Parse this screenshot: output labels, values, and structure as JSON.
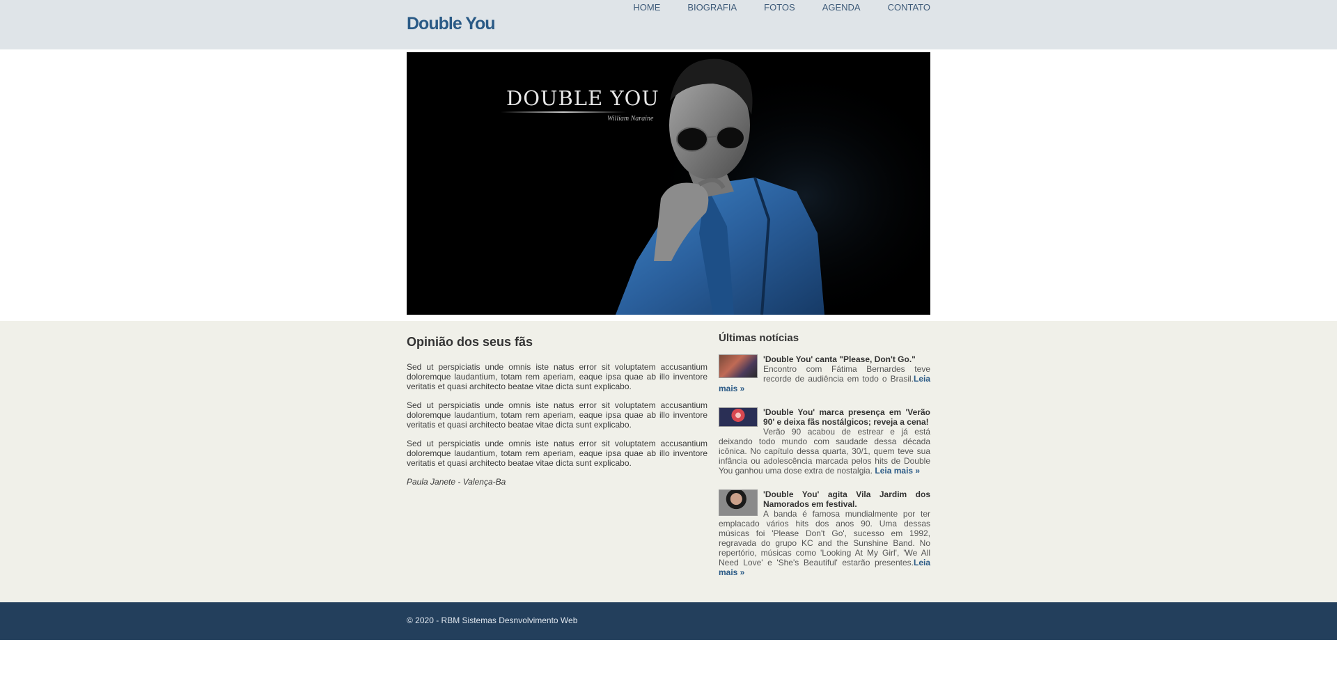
{
  "site": {
    "logo": "Double You"
  },
  "nav": {
    "items": [
      "HOME",
      "BIOGRAFIA",
      "FOTOS",
      "AGENDA",
      "CONTATO"
    ]
  },
  "hero": {
    "title": "DOUBLE YOU",
    "subtitle": "William Naraine"
  },
  "fans": {
    "heading": "Opinião dos seus fãs",
    "paragraphs": [
      "Sed ut perspiciatis unde omnis iste natus error sit voluptatem accusantium doloremque laudantium, totam rem aperiam, eaque ipsa quae ab illo inventore veritatis et quasi architecto beatae vitae dicta sunt explicabo.",
      "Sed ut perspiciatis unde omnis iste natus error sit voluptatem accusantium doloremque laudantium, totam rem aperiam, eaque ipsa quae ab illo inventore veritatis et quasi architecto beatae vitae dicta sunt explicabo.",
      "Sed ut perspiciatis unde omnis iste natus error sit voluptatem accusantium doloremque laudantium, totam rem aperiam, eaque ipsa quae ab illo inventore veritatis et quasi architecto beatae vitae dicta sunt explicabo."
    ],
    "signature": "Paula Janete - Valença-Ba"
  },
  "news": {
    "heading": "Últimas notícias",
    "items": [
      {
        "title": "'Double You' canta \"Please, Don't Go.\"",
        "text": "Encontro com Fátima Bernardes teve recorde de audiência em todo o Brasil.",
        "link": "Leia mais »"
      },
      {
        "title": "'Double You' marca presença em 'Verão 90' e deixa fãs nostálgicos; reveja a cena!",
        "text": "Verão 90 acabou de estrear e já está deixando todo mundo com saudade dessa década icônica. No capítulo dessa quarta, 30/1, quem teve sua infância ou adolescência marcada pelos hits de Double You ganhou uma dose extra de nostalgia. ",
        "link": "Leia mais »"
      },
      {
        "title": "'Double You' agita Vila Jardim dos Namorados em festival.",
        "text": "A banda é famosa mundialmente por ter emplacado vários hits dos anos 90. Uma dessas músicas foi 'Please Don't Go', sucesso em 1992, regravada do grupo KC and the Sunshine Band. No repertório, músicas como 'Looking At My Girl', 'We All Need Love' e 'She's Beautiful' estarão presentes.",
        "link": "Leia mais »"
      }
    ]
  },
  "footer": {
    "copyright": "© 2020 - RBM Sistemas Desnvolvimento Web"
  }
}
